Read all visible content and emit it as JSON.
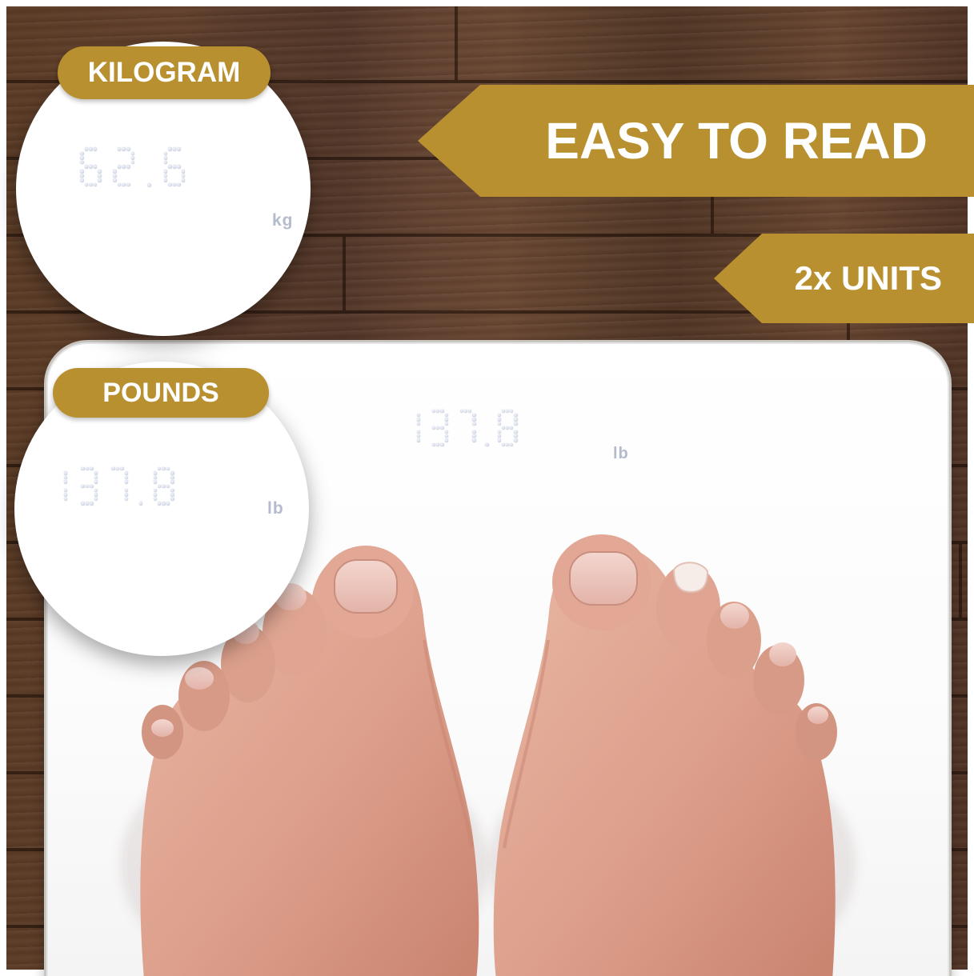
{
  "banners": {
    "easy_to_read": "EASY TO READ",
    "units": "2x UNITS"
  },
  "kilogram_callout": {
    "label": "KILOGRAM",
    "reading": "62.6",
    "unit": "kg"
  },
  "pounds_callout": {
    "label": "POUNDS",
    "reading": "137.8",
    "unit": "lb"
  },
  "scale_display": {
    "reading": "137.8",
    "unit": "lb"
  },
  "colors": {
    "accent_gold": "#b8902f",
    "scale_white": "#ffffff",
    "wood": "#5f3f2a",
    "digit_dot": "#c9cfdd"
  }
}
